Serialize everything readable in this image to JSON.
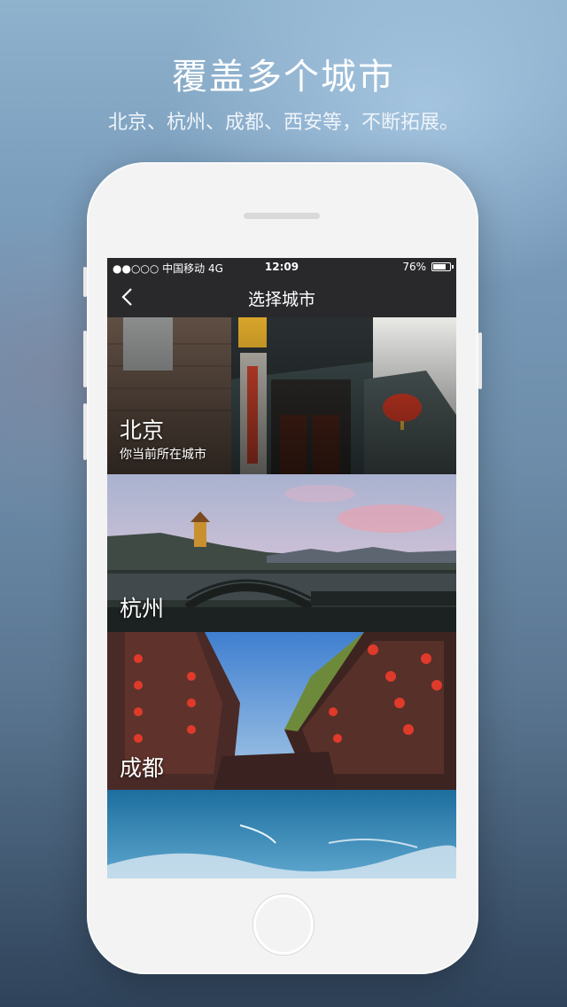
{
  "promo": {
    "headline": "覆盖多个城市",
    "subline": "北京、杭州、成都、西安等，不断拓展。"
  },
  "status_bar": {
    "carrier": "●●○○○ 中国移动 4G",
    "time": "12:09",
    "battery": "76%",
    "battery_level": 0.76
  },
  "nav": {
    "back_icon": "chevron-left-icon",
    "title": "选择城市"
  },
  "cities": [
    {
      "name": "北京",
      "subtitle": "你当前所在城市"
    },
    {
      "name": "杭州"
    },
    {
      "name": "成都"
    },
    {
      "name": ""
    }
  ]
}
